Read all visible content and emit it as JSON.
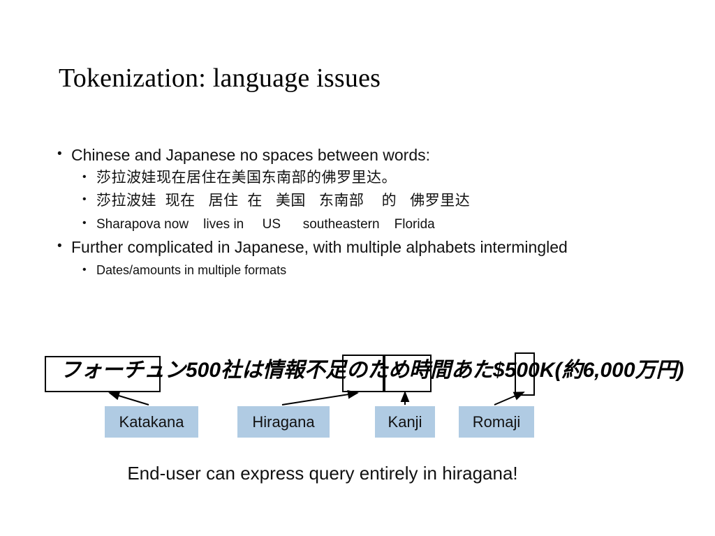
{
  "slide": {
    "title": "Tokenization: language issues",
    "background_color": "#ffffff",
    "text_color": "#000000",
    "accent_color": "#b0cbe3"
  },
  "bullets": {
    "item1": "Chinese and Japanese no spaces between words:",
    "item1_subs": [
      "莎拉波娃现在居住在美国东南部的佛罗里达。",
      "莎拉波娃  现在   居住  在   美国   东南部    的   佛罗里达",
      "Sharapova now    lives in     US      southeastern    Florida"
    ],
    "item2": "Further complicated in Japanese, with multiple alphabets intermingled",
    "item2_subs": [
      "Dates/amounts in multiple formats"
    ]
  },
  "example": {
    "sentence": "フォーチュン500社は情報不足のため時間あた$500K(約6,000万円)",
    "labels": {
      "katakana": "Katakana",
      "hiragana": "Hiragana",
      "kanji": "Kanji",
      "romaji": "Romaji"
    },
    "label_fill_color": "#b0cbe3",
    "box_outline_color": "#000000"
  },
  "footer": {
    "note": "End-user can express query entirely in hiragana!"
  }
}
